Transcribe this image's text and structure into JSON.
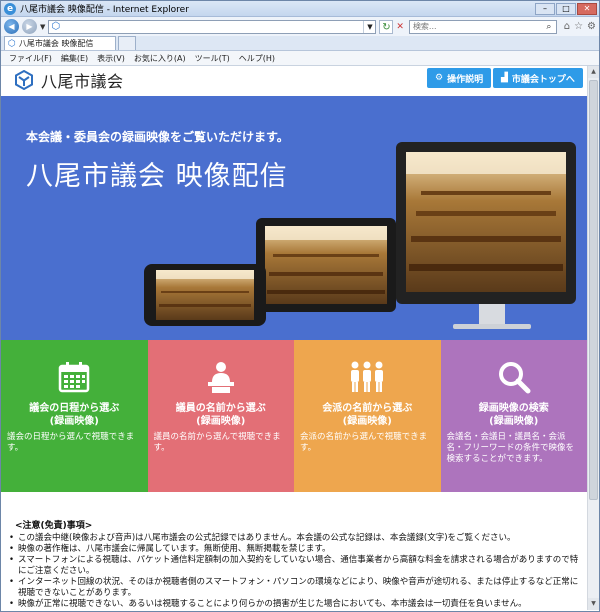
{
  "browser": {
    "window_title": "八尾市議会 映像配信 - Internet Explorer",
    "search_placeholder": "検索...",
    "tab_title": "八尾市議会 映像配信",
    "menu": [
      "ファイル(F)",
      "編集(E)",
      "表示(V)",
      "お気に入り(A)",
      "ツール(T)",
      "ヘルプ(H)"
    ]
  },
  "header": {
    "site_title": "八尾市議会",
    "help_button": "操作説明",
    "top_button": "市議会トップへ"
  },
  "hero": {
    "subtitle": "本会議・委員会の録画映像をご覧いただけます。",
    "title": "八尾市議会 映像配信"
  },
  "tiles": [
    {
      "label_line1": "議会の日程から選ぶ",
      "label_line2": "(録画映像)",
      "desc": "議会の日程から選んで視聴できます。",
      "icon": "calendar-icon",
      "color": "#44b03a"
    },
    {
      "label_line1": "議員の名前から選ぶ",
      "label_line2": "(録画映像)",
      "desc": "議員の名前から選んで視聴できます。",
      "icon": "speaker-podium-icon",
      "color": "#e36f76"
    },
    {
      "label_line1": "会派の名前から選ぶ",
      "label_line2": "(録画映像)",
      "desc": "会派の名前から選んで視聴できます。",
      "icon": "group-people-icon",
      "color": "#eea64e"
    },
    {
      "label_line1": "録画映像の検索",
      "label_line2": "(録画映像)",
      "desc": "会議名・会議日・議員名・会派名・フリーワードの条件で映像を検索することができます。",
      "icon": "magnifier-icon",
      "color": "#ad74bd"
    }
  ],
  "notice": {
    "heading": "<注意(免責)事項>",
    "items": [
      "この議会中継(映像および音声)は八尾市議会の公式記録ではありません。本会議の公式な記録は、本会議録(文字)をご覧ください。",
      "映像の著作権は、八尾市議会に帰属しています。無断使用、無断掲載を禁じます。",
      "スマートフォンによる視聴は、パケット通信料定額制の加入契約をしていない場合、通信事業者から高額な料金を請求される場合がありますので特にご注意ください。",
      "インターネット回線の状況、そのほか視聴者側のスマートフォン・パソコンの環境などにより、映像や音声が途切れる、または停止するなど正常に視聴できないことがあります。",
      "映像が正常に視聴できない、あるいは視聴することにより何らかの損害が生じた場合においても、本市議会は一切責任を負いません。"
    ]
  }
}
